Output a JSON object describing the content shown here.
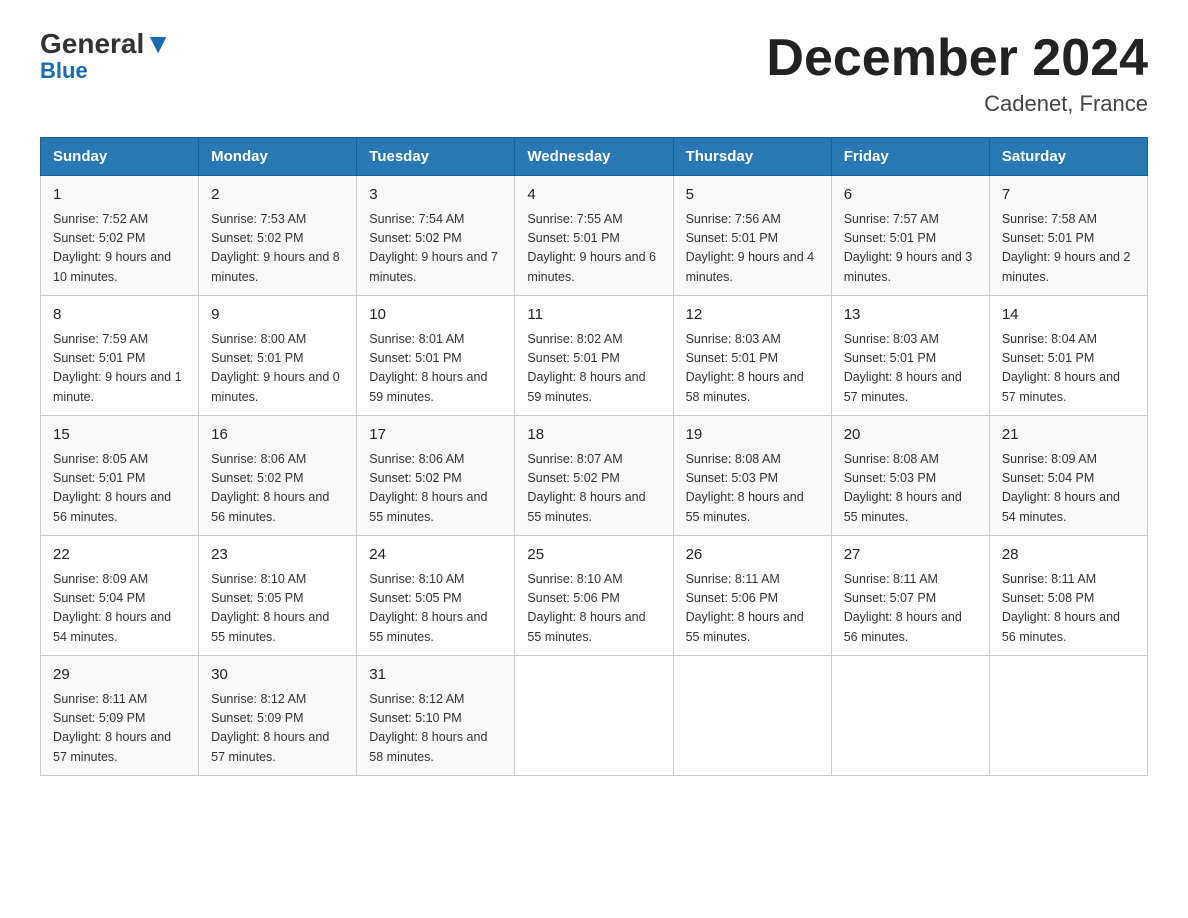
{
  "header": {
    "logo_general": "General",
    "logo_blue": "Blue",
    "month_title": "December 2024",
    "location": "Cadenet, France"
  },
  "days_of_week": [
    "Sunday",
    "Monday",
    "Tuesday",
    "Wednesday",
    "Thursday",
    "Friday",
    "Saturday"
  ],
  "weeks": [
    [
      {
        "num": "1",
        "sunrise": "7:52 AM",
        "sunset": "5:02 PM",
        "daylight": "9 hours and 10 minutes."
      },
      {
        "num": "2",
        "sunrise": "7:53 AM",
        "sunset": "5:02 PM",
        "daylight": "9 hours and 8 minutes."
      },
      {
        "num": "3",
        "sunrise": "7:54 AM",
        "sunset": "5:02 PM",
        "daylight": "9 hours and 7 minutes."
      },
      {
        "num": "4",
        "sunrise": "7:55 AM",
        "sunset": "5:01 PM",
        "daylight": "9 hours and 6 minutes."
      },
      {
        "num": "5",
        "sunrise": "7:56 AM",
        "sunset": "5:01 PM",
        "daylight": "9 hours and 4 minutes."
      },
      {
        "num": "6",
        "sunrise": "7:57 AM",
        "sunset": "5:01 PM",
        "daylight": "9 hours and 3 minutes."
      },
      {
        "num": "7",
        "sunrise": "7:58 AM",
        "sunset": "5:01 PM",
        "daylight": "9 hours and 2 minutes."
      }
    ],
    [
      {
        "num": "8",
        "sunrise": "7:59 AM",
        "sunset": "5:01 PM",
        "daylight": "9 hours and 1 minute."
      },
      {
        "num": "9",
        "sunrise": "8:00 AM",
        "sunset": "5:01 PM",
        "daylight": "9 hours and 0 minutes."
      },
      {
        "num": "10",
        "sunrise": "8:01 AM",
        "sunset": "5:01 PM",
        "daylight": "8 hours and 59 minutes."
      },
      {
        "num": "11",
        "sunrise": "8:02 AM",
        "sunset": "5:01 PM",
        "daylight": "8 hours and 59 minutes."
      },
      {
        "num": "12",
        "sunrise": "8:03 AM",
        "sunset": "5:01 PM",
        "daylight": "8 hours and 58 minutes."
      },
      {
        "num": "13",
        "sunrise": "8:03 AM",
        "sunset": "5:01 PM",
        "daylight": "8 hours and 57 minutes."
      },
      {
        "num": "14",
        "sunrise": "8:04 AM",
        "sunset": "5:01 PM",
        "daylight": "8 hours and 57 minutes."
      }
    ],
    [
      {
        "num": "15",
        "sunrise": "8:05 AM",
        "sunset": "5:01 PM",
        "daylight": "8 hours and 56 minutes."
      },
      {
        "num": "16",
        "sunrise": "8:06 AM",
        "sunset": "5:02 PM",
        "daylight": "8 hours and 56 minutes."
      },
      {
        "num": "17",
        "sunrise": "8:06 AM",
        "sunset": "5:02 PM",
        "daylight": "8 hours and 55 minutes."
      },
      {
        "num": "18",
        "sunrise": "8:07 AM",
        "sunset": "5:02 PM",
        "daylight": "8 hours and 55 minutes."
      },
      {
        "num": "19",
        "sunrise": "8:08 AM",
        "sunset": "5:03 PM",
        "daylight": "8 hours and 55 minutes."
      },
      {
        "num": "20",
        "sunrise": "8:08 AM",
        "sunset": "5:03 PM",
        "daylight": "8 hours and 55 minutes."
      },
      {
        "num": "21",
        "sunrise": "8:09 AM",
        "sunset": "5:04 PM",
        "daylight": "8 hours and 54 minutes."
      }
    ],
    [
      {
        "num": "22",
        "sunrise": "8:09 AM",
        "sunset": "5:04 PM",
        "daylight": "8 hours and 54 minutes."
      },
      {
        "num": "23",
        "sunrise": "8:10 AM",
        "sunset": "5:05 PM",
        "daylight": "8 hours and 55 minutes."
      },
      {
        "num": "24",
        "sunrise": "8:10 AM",
        "sunset": "5:05 PM",
        "daylight": "8 hours and 55 minutes."
      },
      {
        "num": "25",
        "sunrise": "8:10 AM",
        "sunset": "5:06 PM",
        "daylight": "8 hours and 55 minutes."
      },
      {
        "num": "26",
        "sunrise": "8:11 AM",
        "sunset": "5:06 PM",
        "daylight": "8 hours and 55 minutes."
      },
      {
        "num": "27",
        "sunrise": "8:11 AM",
        "sunset": "5:07 PM",
        "daylight": "8 hours and 56 minutes."
      },
      {
        "num": "28",
        "sunrise": "8:11 AM",
        "sunset": "5:08 PM",
        "daylight": "8 hours and 56 minutes."
      }
    ],
    [
      {
        "num": "29",
        "sunrise": "8:11 AM",
        "sunset": "5:09 PM",
        "daylight": "8 hours and 57 minutes."
      },
      {
        "num": "30",
        "sunrise": "8:12 AM",
        "sunset": "5:09 PM",
        "daylight": "8 hours and 57 minutes."
      },
      {
        "num": "31",
        "sunrise": "8:12 AM",
        "sunset": "5:10 PM",
        "daylight": "8 hours and 58 minutes."
      },
      null,
      null,
      null,
      null
    ]
  ]
}
